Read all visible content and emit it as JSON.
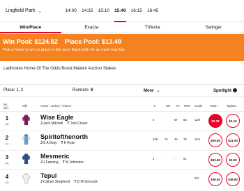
{
  "venue": "Lingfield Park",
  "times": [
    "14:00",
    "14:35",
    "15:10",
    "15:40",
    "16:15",
    "16:45"
  ],
  "active_time_index": 3,
  "tabs": [
    "Win/Place",
    "Exacta",
    "Trifecta",
    "Swinger"
  ],
  "active_tab_index": 0,
  "pool": {
    "win": "Win Pool: $124.52",
    "place": "Place Pool: $13.49",
    "hint": "Pick a horse to win or place in the race. Back both for an each way bet."
  },
  "race_title": "Ladbrokes Home Of The Odds Boost Maiden Auction Stakes",
  "info": {
    "place": "Place: 1, 2",
    "runners_label": "Runners:",
    "runners_value": "6",
    "more": "More",
    "spotlight": "Spotlight"
  },
  "columns": {
    "no": "No.",
    "dr": "(Dr)",
    "silk": "Silk",
    "horse": "Horse / Jockey / Trainer",
    "f": "F",
    "or": "OR",
    "ts": "TS",
    "rpr": "RPR",
    "guide": "Guide",
    "towin": "Towin",
    "toplace": "Toplace"
  },
  "runners": [
    {
      "no": "1",
      "draw": "(5)",
      "name": "Wise Eagle",
      "jockey": "Jack Mitchell",
      "trainer": "Tom Clover",
      "f": "4",
      "or": "-",
      "ts": "67",
      "rpr": "83",
      "guide": "11/8",
      "win": "$2.38",
      "place": "$1.10",
      "win_filled": true,
      "silk": {
        "body": "#7a1a5c",
        "sleeve": "#9a2a74",
        "cap": "#7a1a5c"
      }
    },
    {
      "no": "2",
      "draw": "(1)",
      "name": "Spiritofthenorth",
      "jockey": "S A Gray",
      "trainer": "K Ryan",
      "f": "345-",
      "or": "74",
      "ts": "34",
      "rpr": "79",
      "guide": "11/4",
      "win": "$39.50",
      "place": "$21.00",
      "win_filled": false,
      "silk": {
        "body": "#6a9fd6",
        "sleeve": "#d9e6f3",
        "cap": "#4a7fc0"
      }
    },
    {
      "no": "3",
      "draw": "(4)",
      "name": "Mesmeric",
      "jockey": "J Fanning",
      "trainer": "M Johnston",
      "f": "4",
      "or": "-",
      "ts": "-",
      "rpr": "61",
      "guide": "",
      "win": "$93.60",
      "place": "$0.00",
      "win_filled": false,
      "silk": {
        "body": "#2d4f8a",
        "sleeve": "#2d4f8a",
        "cap": "#2d4f8a"
      }
    },
    {
      "no": "4",
      "draw": "(2)",
      "name": "Tepui",
      "jockey": "Callum Shepherd",
      "trainer": "D M Simcock",
      "f": "",
      "or": "",
      "ts": "",
      "rpr": "",
      "guide": "5/2",
      "win": "$39.50",
      "place": "$39.50",
      "win_filled": false,
      "silk": {
        "body": "#f2f2f2",
        "sleeve": "#e0e0e0",
        "cap": "#cccccc"
      }
    }
  ]
}
